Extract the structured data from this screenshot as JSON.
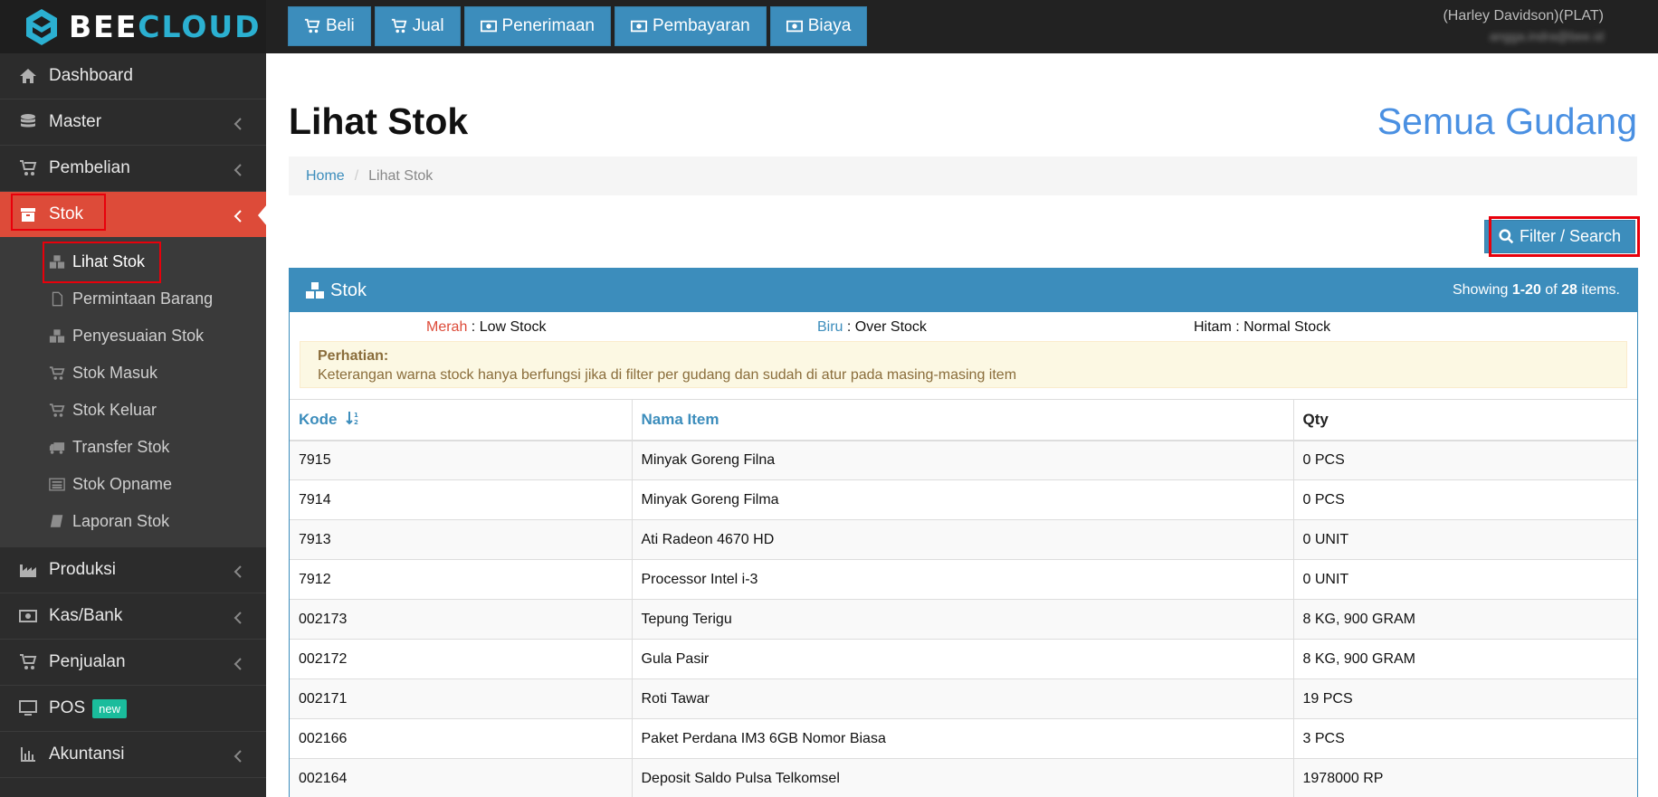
{
  "brand": {
    "part1": "BEE",
    "part2": "CLOUD"
  },
  "topnav": [
    {
      "label": "Beli",
      "icon": "cart-icon"
    },
    {
      "label": "Jual",
      "icon": "cart-icon"
    },
    {
      "label": "Penerimaan",
      "icon": "money-icon"
    },
    {
      "label": "Pembayaran",
      "icon": "money-icon"
    },
    {
      "label": "Biaya",
      "icon": "money-icon"
    }
  ],
  "user": {
    "company": "(Harley Davidson)(PLAT)",
    "email": "angga.indra@bee.id"
  },
  "sidebar": {
    "items": [
      {
        "label": "Dashboard",
        "icon": "home-icon"
      },
      {
        "label": "Master",
        "icon": "database-icon"
      },
      {
        "label": "Pembelian",
        "icon": "cart-icon"
      },
      {
        "label": "Stok",
        "icon": "archive-icon"
      },
      {
        "label": "Produksi",
        "icon": "factory-icon"
      },
      {
        "label": "Kas/Bank",
        "icon": "money-icon"
      },
      {
        "label": "Penjualan",
        "icon": "cart-icon"
      },
      {
        "label": "POS",
        "icon": "monitor-icon",
        "badge": "new"
      },
      {
        "label": "Akuntansi",
        "icon": "bar-chart-icon"
      }
    ],
    "stok_submenu": [
      {
        "label": "Lihat Stok",
        "icon": "cubes-icon"
      },
      {
        "label": "Permintaan Barang",
        "icon": "file-icon"
      },
      {
        "label": "Penyesuaian Stok",
        "icon": "cubes-icon"
      },
      {
        "label": "Stok Masuk",
        "icon": "cart-icon"
      },
      {
        "label": "Stok Keluar",
        "icon": "cart-icon"
      },
      {
        "label": "Transfer Stok",
        "icon": "truck-icon"
      },
      {
        "label": "Stok Opname",
        "icon": "list-icon"
      },
      {
        "label": "Laporan Stok",
        "icon": "book-icon"
      }
    ]
  },
  "page": {
    "title": "Lihat Stok",
    "warehouse": "Semua Gudang",
    "breadcrumb": {
      "home": "Home",
      "current": "Lihat Stok"
    },
    "filter_button": "Filter / Search"
  },
  "panel": {
    "title": "Stok",
    "summary_prefix": "Showing ",
    "summary_range": "1-20",
    "summary_of": " of ",
    "summary_total": "28",
    "summary_suffix": " items.",
    "legend": [
      {
        "key": "Merah",
        "sep": " : ",
        "desc": "Low Stock",
        "color": "#dd4b39"
      },
      {
        "key": "Biru",
        "sep": " : ",
        "desc": "Over Stock",
        "color": "#3c8dbc"
      },
      {
        "key": "Hitam",
        "sep": " : ",
        "desc": "Normal Stock",
        "color": "#111111"
      }
    ],
    "notice_title": "Perhatian:",
    "notice_text": "Keterangan warna stock hanya berfungsi jika di filter per gudang dan sudah di atur pada masing-masing item"
  },
  "table": {
    "columns": [
      "Kode",
      "Nama Item",
      "Qty"
    ],
    "rows": [
      [
        "7915",
        "Minyak Goreng Filna",
        "0 PCS"
      ],
      [
        "7914",
        "Minyak Goreng Filma",
        "0 PCS"
      ],
      [
        "7913",
        "Ati Radeon 4670 HD",
        "0 UNIT"
      ],
      [
        "7912",
        "Processor Intel i-3",
        "0 UNIT"
      ],
      [
        "002173",
        "Tepung Terigu",
        "8 KG, 900 GRAM"
      ],
      [
        "002172",
        "Gula Pasir",
        "8 KG, 900 GRAM"
      ],
      [
        "002171",
        "Roti Tawar",
        "19 PCS"
      ],
      [
        "002166",
        "Paket Perdana IM3 6GB Nomor Biasa",
        "3 PCS"
      ],
      [
        "002164",
        "Deposit Saldo Pulsa Telkomsel",
        "1978000 RP"
      ]
    ]
  }
}
